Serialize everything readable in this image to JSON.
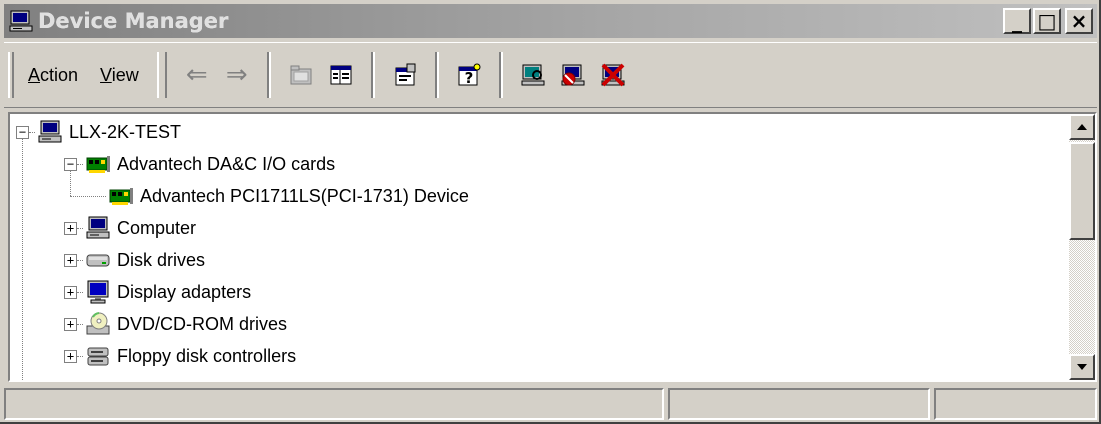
{
  "window": {
    "title": "Device Manager",
    "buttons": {
      "minimize": "_",
      "maximize": "□",
      "close": "×"
    }
  },
  "toolbar": {
    "menus": [
      "Action",
      "View"
    ],
    "icons": [
      "back-arrow-icon",
      "forward-arrow-icon",
      "up-folder-icon",
      "show-hide-tree-icon",
      "properties-icon",
      "help-icon",
      "scan-hardware-icon",
      "disable-device-icon",
      "uninstall-device-icon"
    ],
    "back_glyph": "⇐",
    "forward_glyph": "⇒"
  },
  "tree": {
    "root": {
      "label": "LLX-2K-TEST",
      "expander": "−"
    },
    "items": [
      {
        "label": "Advantech DA&C I/O cards",
        "expander": "−",
        "icon": "io-card-icon"
      },
      {
        "label": "Advantech PCI1711LS(PCI-1731) Device",
        "icon": "io-card-icon"
      },
      {
        "label": "Computer",
        "expander": "+",
        "icon": "computer-icon"
      },
      {
        "label": "Disk drives",
        "expander": "+",
        "icon": "disk-drive-icon"
      },
      {
        "label": "Display adapters",
        "expander": "+",
        "icon": "display-adapter-icon"
      },
      {
        "label": "DVD/CD-ROM drives",
        "expander": "+",
        "icon": "cdrom-icon"
      },
      {
        "label": "Floppy disk controllers",
        "expander": "+",
        "icon": "floppy-controller-icon"
      }
    ]
  },
  "statusbar": {
    "panels": [
      "",
      "",
      ""
    ]
  },
  "colors": {
    "face": "#d4d0c8",
    "title_inactive_start": "#808080",
    "title_inactive_end": "#c0c0c0",
    "tree_bg": "#ffffff"
  }
}
